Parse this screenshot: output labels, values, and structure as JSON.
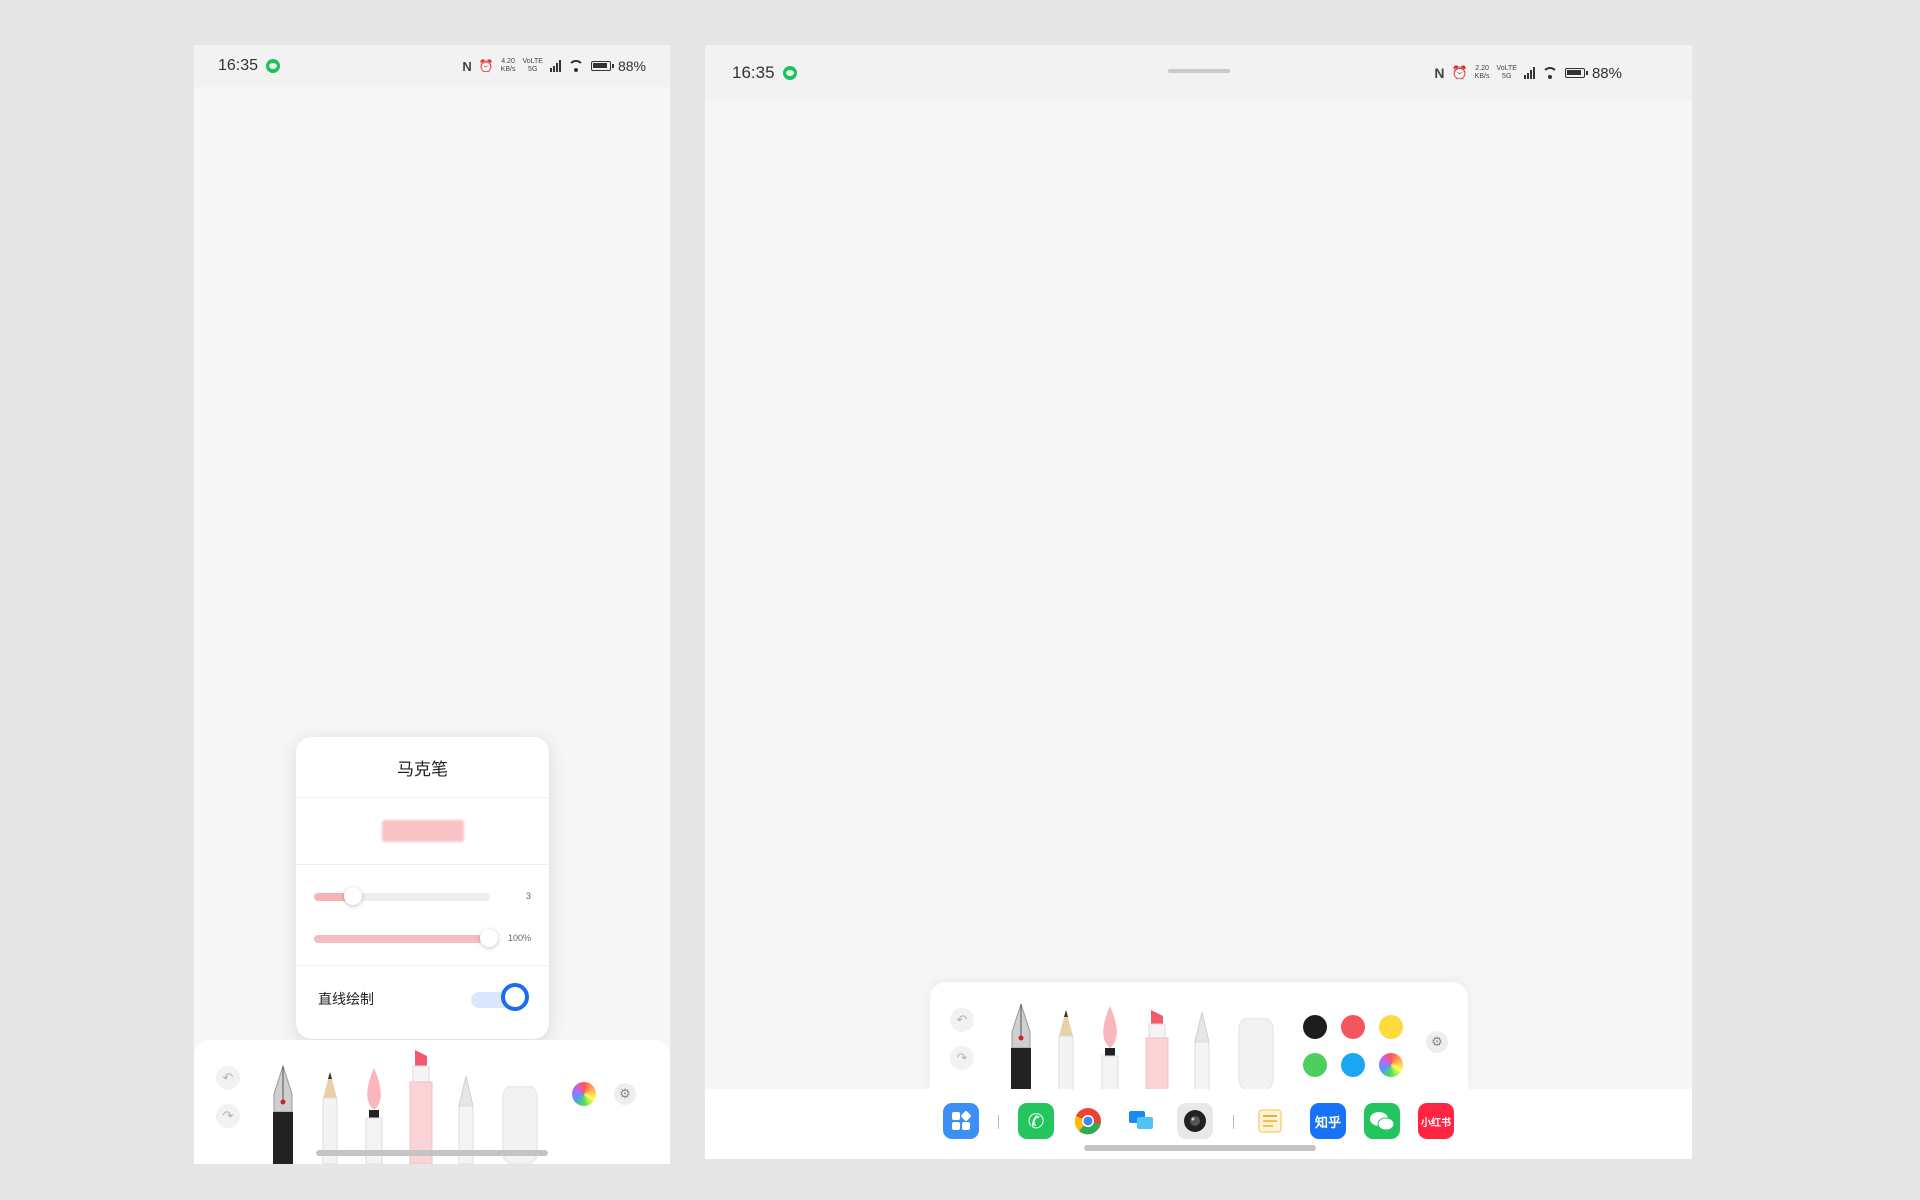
{
  "phone": {
    "status_time": "16:35",
    "net_speed": "4.20\nKB/s",
    "net_type": "VoLTE 5G",
    "battery": "88%"
  },
  "tablet": {
    "status_time": "16:35",
    "net_speed": "2.20\nKB/s",
    "net_type": "VoLTE 5G",
    "battery": "88%"
  },
  "popup": {
    "title": "马克笔",
    "size_value": "3",
    "opacity_value": "100%",
    "straight_line_label": "直线绘制",
    "straight_line_enabled": true,
    "size_fraction": 0.18,
    "opacity_fraction": 1.0
  },
  "toolbar": {
    "undo_icon": "undo-icon",
    "redo_icon": "redo-icon",
    "tools": [
      "fountain-pen",
      "pencil",
      "brush",
      "marker",
      "ballpoint-pen",
      "eraser"
    ],
    "selected_tool": "marker"
  },
  "palette": {
    "colors": [
      "#1d1d1d",
      "#f5565b",
      "#fddb3a",
      "#4ccf5e",
      "#1aa5f5",
      "multicolor"
    ]
  },
  "dock": {
    "apps": [
      "app-grid",
      "phone",
      "chrome",
      "messages",
      "camera",
      "notes",
      "知乎",
      "wechat",
      "小红书"
    ],
    "zhihu_label": "知乎",
    "xhs_label": "小红书"
  }
}
